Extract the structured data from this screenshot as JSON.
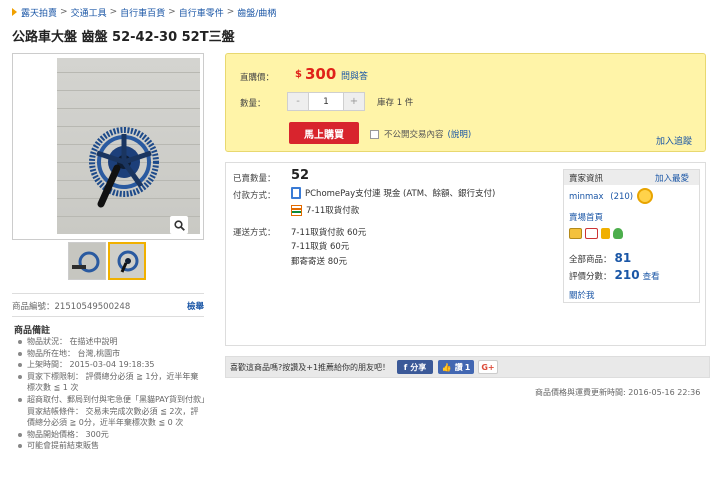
{
  "breadcrumb": [
    "露天拍賣",
    "交通工具",
    "自行車百貨",
    "自行車零件",
    "齒盤/曲柄"
  ],
  "title": "公路車大盤 齒盤 52-42-30 52T三盤",
  "left": {
    "product_id_label": "商品編號：",
    "product_id": "21510549500248",
    "report_link": "檢舉",
    "notes_title": "商品備註",
    "notes": [
      "物品狀況： 在描述中說明",
      "物品所在地： 台灣,桃園市",
      "上架時間： 2015-03-04 19:18:35",
      "買家下標限制： 評價總分必須 ≧ 1分，近半年棄標次數 ≦ 1 次",
      "超商取付、郵局到付與宅急便「黑貓PAY貨到付款」買家結帳條件： 交易未完成次數必須 ≦ 2次，評價總分必須 ≧ 0分，近半年棄標次數 ≦ 0 次",
      "物品開始價格： 300元",
      "可能會提前結束販售"
    ]
  },
  "buy": {
    "price_label": "直購價：",
    "currency": "$",
    "price": "300",
    "qa_link": "問與答",
    "qty_label": "數量：",
    "qty_minus": "-",
    "qty_value": "1",
    "qty_plus": "+",
    "stock": "庫存 1 件",
    "buy_button": "馬上購買",
    "private_text": "不公開交易內容",
    "explain_link": "(說明)",
    "track_link": "加入追蹤"
  },
  "details": {
    "sold_label": "已賣數量：",
    "sold": "52",
    "pay_label": "付款方式：",
    "pay_method_1": "PChomePay支付連 現金 (ATM、餘額、銀行支付)",
    "pay_method_2": "7-11取貨付款",
    "ship_label": "運送方式：",
    "ship_lines": [
      "7-11取貨付款 60元",
      "7-11取貨 60元",
      "郵寄寄送 80元"
    ]
  },
  "seller": {
    "title": "賣家資訊",
    "add_link": "加入最愛",
    "name": "minmax",
    "rating": "(210)",
    "store_link": "賣場首頁",
    "total_label": "全部商品：",
    "total": "81",
    "score_label": "評價分數：",
    "score": "210",
    "view_link": "查看",
    "ask_link": "關於我"
  },
  "share": {
    "text": "喜歡這商品嗎?按讚及+1推薦給你的朋友吧！",
    "fb_share": "分享",
    "fb_like": "讚",
    "fb_count": "1",
    "gplus": "G+"
  },
  "update_text": "商品價格與運費更新時間: 2016-05-16 22:36",
  "colors": {
    "price": "#e0221a",
    "buy_button": "#d8242d",
    "buy_box": "#fff4a8",
    "link": "#1a56a6"
  }
}
